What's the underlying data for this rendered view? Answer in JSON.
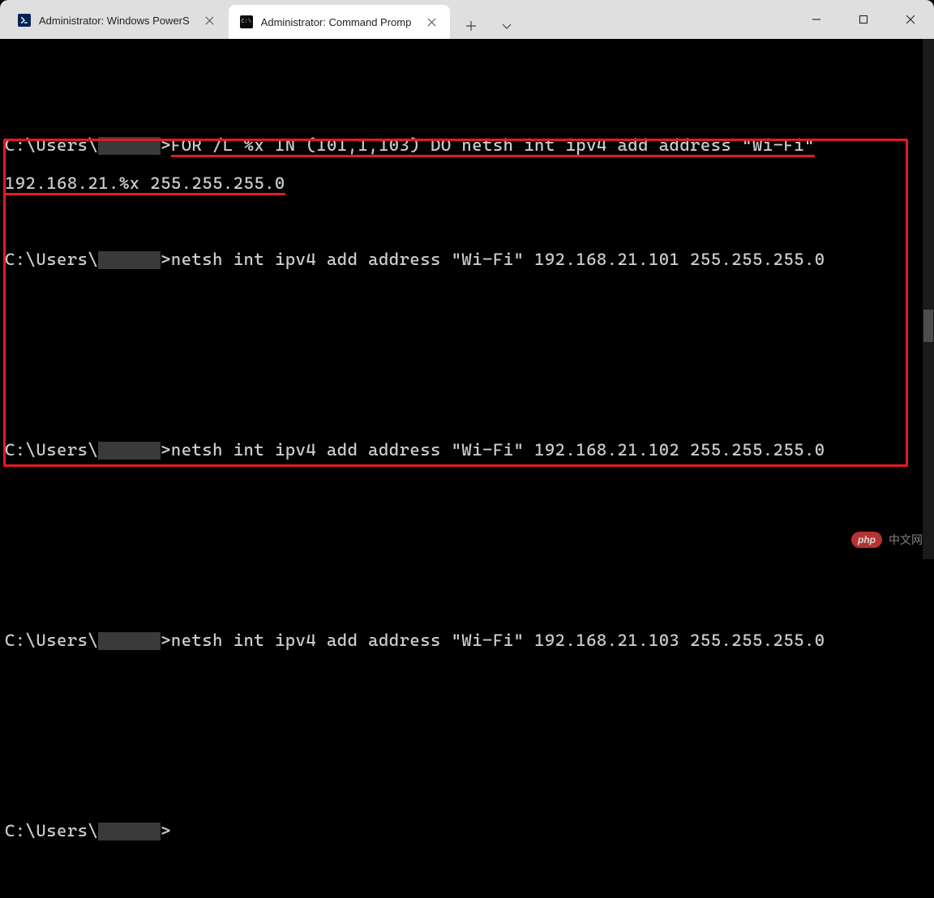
{
  "tabs": [
    {
      "label": "Administrator: Windows PowerS",
      "icon": "powershell",
      "active": false
    },
    {
      "label": "Administrator: Command Promp",
      "icon": "cmd",
      "active": true
    }
  ],
  "terminal": {
    "prompt_prefix": "C:\\Users\\",
    "redacted_user": "      ",
    "prompt_suffix": ">",
    "command_line1": "FOR /L %x IN (101,1,103) DO netsh int ipv4 add address \"Wi-Fi\"",
    "command_line2": "192.168.21.%x 255.255.255.0",
    "outputs": [
      "netsh int ipv4 add address \"Wi-Fi\" 192.168.21.101 255.255.255.0",
      "netsh int ipv4 add address \"Wi-Fi\" 192.168.21.102 255.255.255.0",
      "netsh int ipv4 add address \"Wi-Fi\" 192.168.21.103 255.255.255.0"
    ]
  },
  "watermark": {
    "badge": "php",
    "text": "中文网"
  },
  "annotations": {
    "underline_color": "#e31b23",
    "box_color": "#e31b23"
  }
}
